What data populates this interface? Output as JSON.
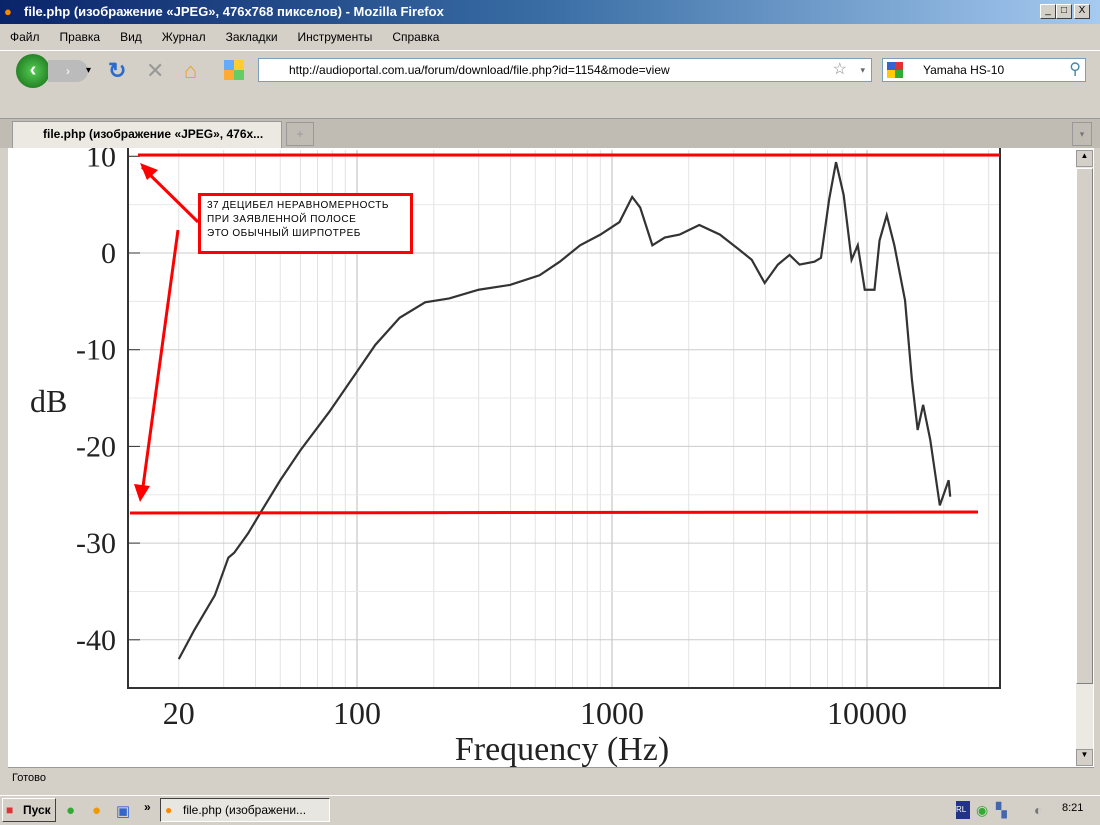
{
  "window": {
    "title": "file.php (изображение «JPEG», 476x768 пикселов) - Mozilla Firefox",
    "min": "_",
    "max": "□",
    "close": "X"
  },
  "menu": [
    "Файл",
    "Правка",
    "Вид",
    "Журнал",
    "Закладки",
    "Инструменты",
    "Справка"
  ],
  "nav": {
    "url": "http://audioportal.com.ua/forum/download/file.php?id=1154&mode=view",
    "search": "Yamaha HS-10",
    "star": "☆"
  },
  "tab": {
    "label": "file.php (изображение «JPEG», 476x...",
    "new": "+"
  },
  "status": "Готово",
  "taskbar": {
    "start": "Пуск",
    "task": "file.php (изображени...",
    "chevron": "»",
    "tray_lang": "RL",
    "clock": "8:21"
  },
  "annotation": {
    "lines": [
      "37 ДЕЦИБЕЛ НЕРАВНОМЕРНОСТЬ",
      "ПРИ ЗАЯВЛЕННОЙ ПОЛОСЕ",
      "ЭТО ОБЫЧНЫЙ ШИРПОТРЕБ"
    ],
    "color": "#ff0000"
  },
  "chart_data": {
    "type": "line",
    "xlabel": "Frequency (Hz)",
    "ylabel": "dB",
    "xscale": "log",
    "xlim": [
      15,
      30000
    ],
    "ylim": [
      -45,
      10
    ],
    "xticks": [
      20,
      100,
      1000,
      10000
    ],
    "xtick_labels": [
      "20",
      "100",
      "1000",
      "10000"
    ],
    "yticks": [
      10,
      0,
      -10,
      -20,
      -30,
      -40
    ],
    "ytick_labels": [
      "10",
      "0",
      "-10",
      "-20",
      "-30",
      "-40"
    ],
    "series": [
      {
        "name": "response",
        "x": [
          20,
          23,
          27.7,
          31.3,
          33,
          37.4,
          42.4,
          50,
          60,
          78,
          98,
          118,
          147,
          185,
          230,
          300,
          398,
          520,
          624,
          750,
          900,
          1070,
          1200,
          1290,
          1440,
          1610,
          1840,
          2200,
          2650,
          3170,
          3530,
          3970,
          4470,
          4970,
          5440,
          6220,
          6600,
          7100,
          7560,
          8100,
          8700,
          9200,
          9800,
          10700,
          11200,
          11950,
          12800,
          14100,
          15000,
          15800,
          16600,
          17700,
          19300,
          20900,
          21200
        ],
        "y": [
          -42,
          -39,
          -35.4,
          -31.5,
          -31,
          -29,
          -26.6,
          -23.5,
          -20.4,
          -16.4,
          -12.6,
          -9.5,
          -6.7,
          -5.1,
          -4.7,
          -3.8,
          -3.3,
          -2.3,
          -0.9,
          0.8,
          1.9,
          3.2,
          5.8,
          4.7,
          0.8,
          1.6,
          1.9,
          2.9,
          1.9,
          0.3,
          -0.7,
          -3.1,
          -1.2,
          -0.2,
          -1.2,
          -0.9,
          -0.5,
          5.5,
          9.4,
          6.0,
          -0.7,
          0.8,
          -3.8,
          -3.8,
          1.3,
          3.9,
          0.8,
          -4.9,
          -13.1,
          -18.3,
          -15.7,
          -19.3,
          -26.1,
          -23.5,
          -25.2
        ]
      }
    ],
    "annotations": {
      "upper_line_db": 10,
      "lower_line_db": -27
    }
  }
}
